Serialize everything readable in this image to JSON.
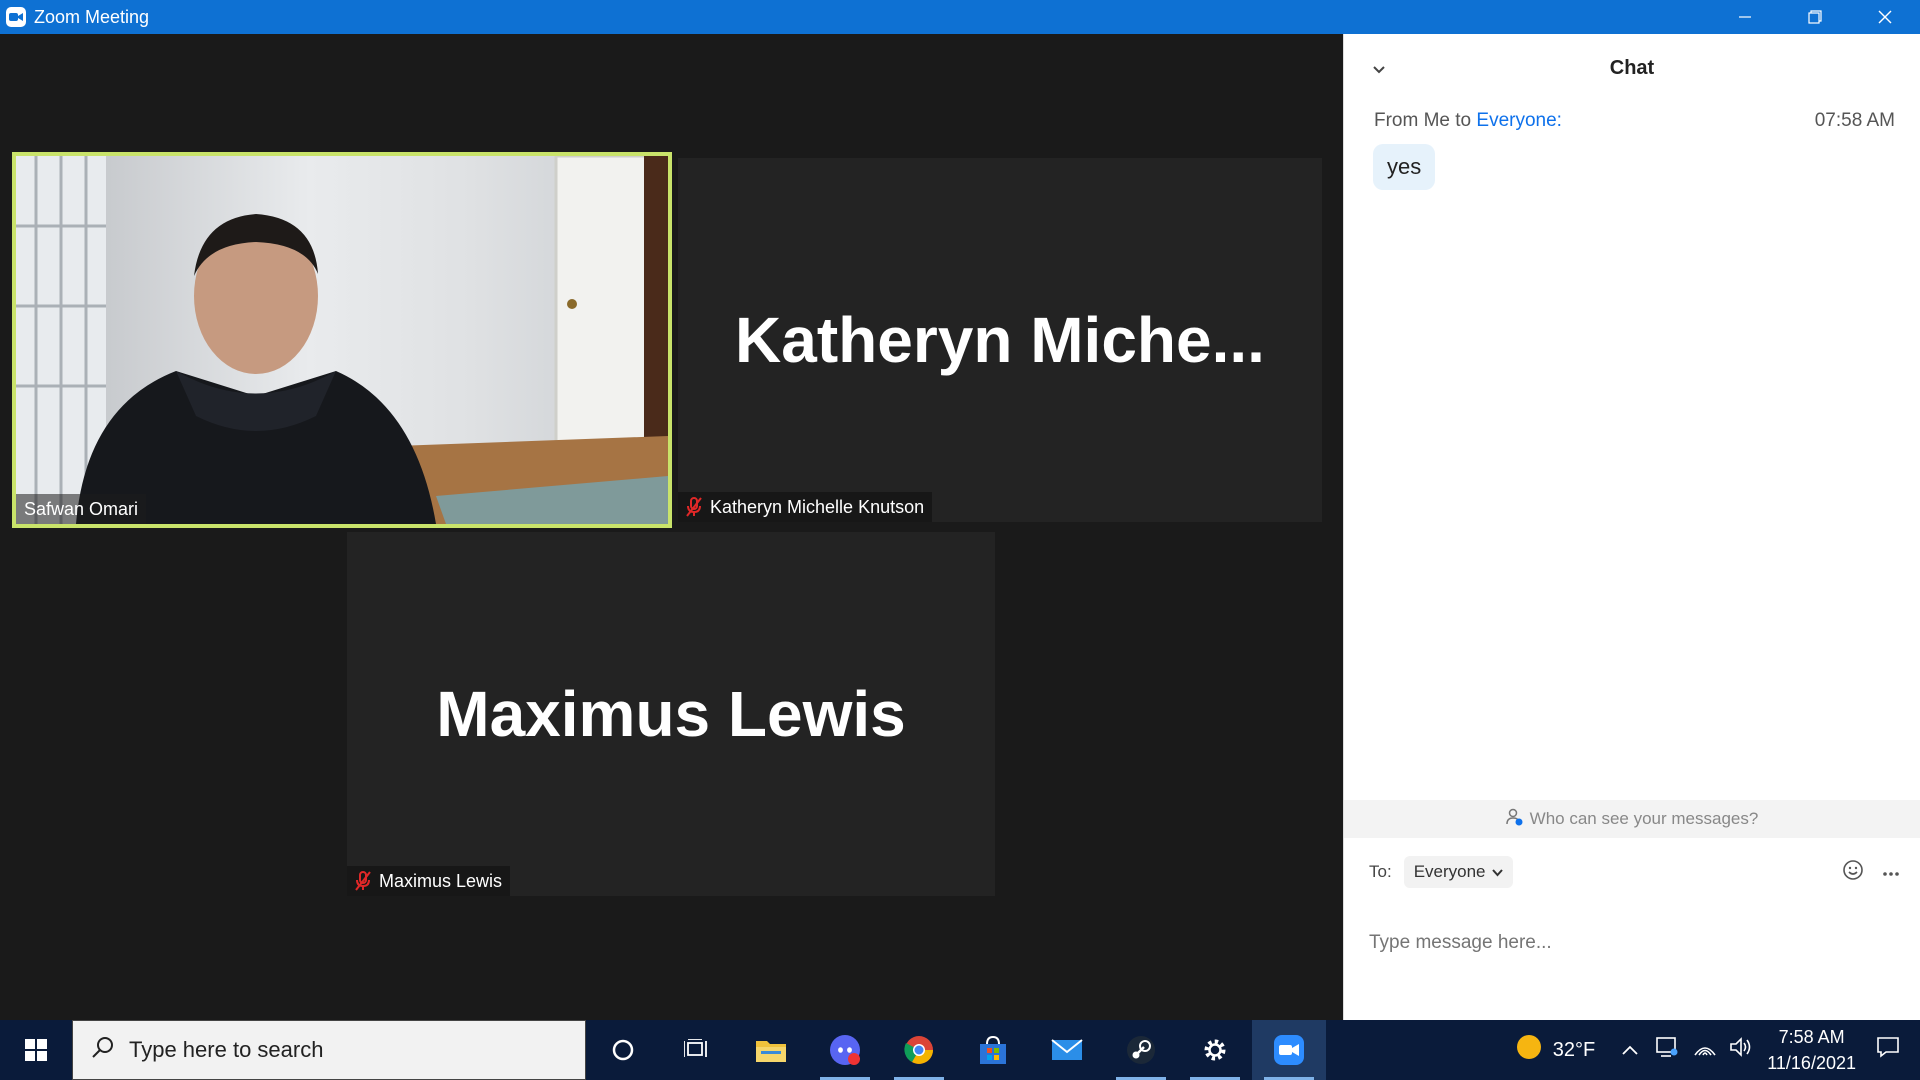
{
  "window": {
    "title": "Zoom Meeting"
  },
  "participants": [
    {
      "name": "Safwan Omari",
      "video": true,
      "active_speaker": true,
      "muted": false
    },
    {
      "name": "Katheryn Michelle Knutson",
      "display_name": "Katheryn  Miche...",
      "video": false,
      "muted": true
    },
    {
      "name": "Maximus Lewis",
      "display_name": "Maximus Lewis",
      "video": false,
      "muted": true
    }
  ],
  "chat": {
    "title": "Chat",
    "messages": [
      {
        "from_label": "From Me to",
        "to_label": "Everyone:",
        "time": "07:58 AM",
        "text": "yes"
      }
    ],
    "privacy_note": "Who can see your messages?",
    "to_label": "To:",
    "to_value": "Everyone",
    "input_placeholder": "Type message here..."
  },
  "taskbar": {
    "search_placeholder": "Type here to search",
    "weather": "32°F",
    "time": "7:58 AM",
    "date": "11/16/2021"
  },
  "colors": {
    "titlebar": "#0e71d3",
    "active_border": "#c9e36a",
    "link": "#0e71eb",
    "muted_icon": "#e02828"
  }
}
